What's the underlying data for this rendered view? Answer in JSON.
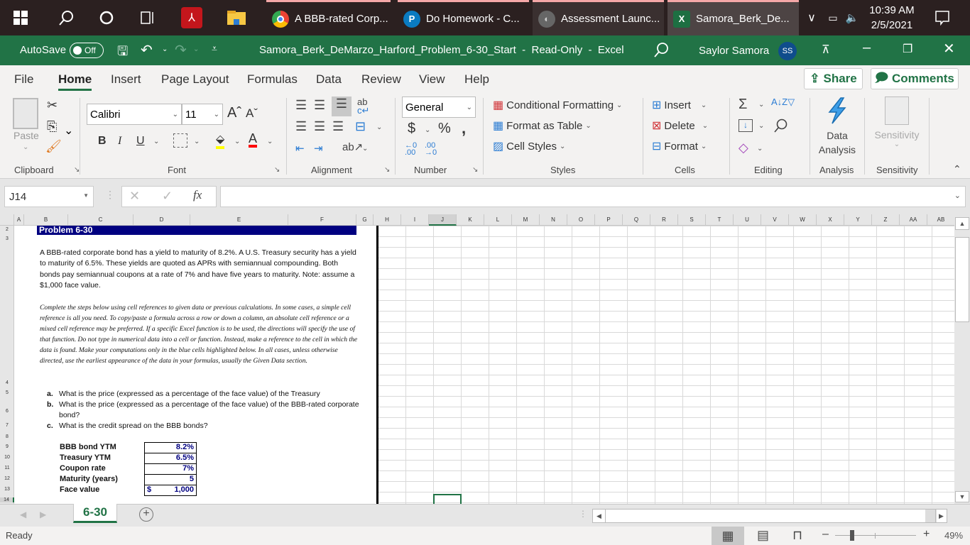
{
  "taskbar": {
    "apps": [
      {
        "label": "A BBB-rated Corp...",
        "icon": "chrome-icon"
      },
      {
        "label": "Do Homework - C...",
        "icon": "pearson-icon"
      },
      {
        "label": "Assessment Launc...",
        "icon": "app-icon"
      },
      {
        "label": "Samora_Berk_De...",
        "icon": "excel-icon"
      }
    ],
    "time": "10:39 AM",
    "date": "2/5/2021"
  },
  "titlebar": {
    "autosave_label": "AutoSave",
    "autosave_state": "Off",
    "title": "Samora_Berk_DeMarzo_Harford_Problem_6-30_Start  -  Read-Only  -  Excel",
    "user_name": "Saylor Samora",
    "user_initials": "SS"
  },
  "menu": {
    "tabs": [
      "File",
      "Home",
      "Insert",
      "Page Layout",
      "Formulas",
      "Data",
      "Review",
      "View",
      "Help"
    ],
    "active": "Home",
    "share_label": "Share",
    "comments_label": "Comments"
  },
  "ribbon": {
    "clipboard": {
      "paste": "Paste",
      "label": "Clipboard"
    },
    "font": {
      "name": "Calibri",
      "size": "11",
      "label": "Font",
      "fill_color": "#ffff00",
      "font_color": "#ff0000"
    },
    "alignment": {
      "label": "Alignment"
    },
    "number": {
      "format": "General",
      "label": "Number"
    },
    "styles": {
      "conditional": "Conditional Formatting",
      "format_table": "Format as Table",
      "cell_styles": "Cell Styles",
      "label": "Styles"
    },
    "cells": {
      "insert": "Insert",
      "delete": "Delete",
      "format": "Format",
      "label": "Cells"
    },
    "editing": {
      "label": "Editing"
    },
    "analysis": {
      "data_analysis_line1": "Data",
      "data_analysis_line2": "Analysis",
      "label": "Analysis"
    },
    "sensitivity": {
      "button": "Sensitivity",
      "label": "Sensitivity"
    }
  },
  "formula_bar": {
    "name_box": "J14",
    "formula": ""
  },
  "columns": [
    "A",
    "B",
    "C",
    "D",
    "E",
    "F",
    "G",
    "H",
    "I",
    "J",
    "K",
    "L",
    "M",
    "N",
    "O",
    "P",
    "Q",
    "R",
    "S",
    "T",
    "U",
    "V",
    "W",
    "X",
    "Y",
    "Z",
    "AA",
    "AB"
  ],
  "rows": [
    "2",
    "3",
    "4",
    "5",
    "6",
    "7",
    "8",
    "9",
    "10",
    "11",
    "12",
    "13",
    "14"
  ],
  "sheet": {
    "title": "Problem 6-30",
    "problem_text": "A BBB-rated corporate bond has a yield to maturity of 8.2%. A U.S. Treasury security has a yield to maturity of 6.5%. These yields are quoted as APRs with semiannual compounding. Both bonds pay semiannual coupons at a rate of 7% and have five years to maturity. Note: assume a $1,000 face value.",
    "instructions": "Complete the steps below using cell references to given data or previous calculations. In some cases, a simple cell reference is all you need. To copy/paste a formula across a row or down a column, an absolute cell reference or a mixed cell reference may be preferred. If a specific Excel function is to be used, the directions will specify the use of that function. Do not type in numerical data into a cell or function. Instead, make a reference to the cell in which the data is found. Make your computations only in the blue cells highlighted below. In all cases, unless otherwise directed, use the earliest appearance of the data in your formulas, usually the Given Data section.",
    "questions": [
      {
        "letter": "a.",
        "text": "What is the price (expressed as a percentage of the face value) of the Treasury"
      },
      {
        "letter": "b.",
        "text": "What is the price (expressed as a percentage of the face value) of the BBB-rated corporate bond?"
      },
      {
        "letter": "c.",
        "text": "What is the credit spread on the BBB bonds?"
      }
    ],
    "given_data": [
      {
        "label": "BBB bond YTM",
        "value": "8.2%",
        "prefix": ""
      },
      {
        "label": "Treasury YTM",
        "value": "6.5%",
        "prefix": ""
      },
      {
        "label": "Coupon rate",
        "value": "7%",
        "prefix": ""
      },
      {
        "label": "Maturity (years)",
        "value": "5",
        "prefix": ""
      },
      {
        "label": "Face value",
        "value": "1,000",
        "prefix": "$"
      }
    ]
  },
  "sheet_tabs": {
    "active": "6-30"
  },
  "status": {
    "text": "Ready",
    "zoom": "49%",
    "zoom_fraction": 0.49
  }
}
